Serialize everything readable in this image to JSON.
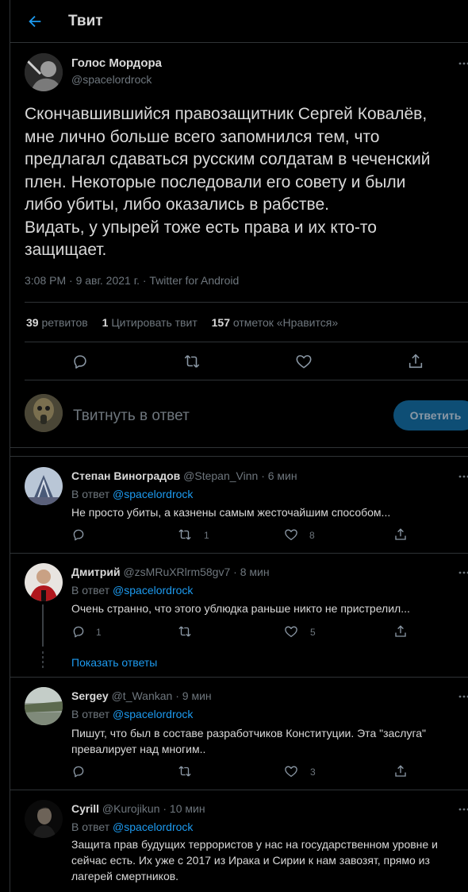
{
  "header": {
    "title": "Твит"
  },
  "main_tweet": {
    "display_name": "Голос Мордора",
    "handle": "@spacelordrock",
    "text_lines": [
      "Скончавшившийся правозащитник Сергей Ковалёв,",
      "мне лично больше всего запомнился тем, что",
      "предлагал сдаваться русским солдатам в чеченский",
      "плен. Некоторые последовали его совету и были",
      "либо убиты, либо оказались в рабстве.",
      "Видать, у упырей тоже есть права и их кто-то",
      "защищает."
    ],
    "meta": "3:08 PM · 9 авг. 2021 г. · Twitter for Android",
    "stats": {
      "retweets_count": "39",
      "retweets_label": "ретвитов",
      "quotes_count": "1",
      "quotes_label": "Цитировать твит",
      "likes_count": "157",
      "likes_label": "отметок «Нравится»"
    }
  },
  "compose": {
    "placeholder": "Твитнуть в ответ",
    "button": "Ответить"
  },
  "reply_prefix": "В ответ",
  "replies": [
    {
      "name": "Степан Виноградов",
      "handle": "@Stepan_Vinn",
      "time": "· 6 мин",
      "reply_to": "@spacelordrock",
      "lines": [
        "Не просто убиты, а казнены самым жесточайшим способом..."
      ],
      "counts": {
        "reply": "",
        "retweet": "1",
        "like": "8"
      }
    },
    {
      "name": "Дмитрий",
      "handle": "@zsMRuXRlrm58gv7",
      "time": "· 8 мин",
      "reply_to": "@spacelordrock",
      "lines": [
        "Очень странно, что этого ублюдка раньше никто не пристрелил..."
      ],
      "counts": {
        "reply": "1",
        "retweet": "",
        "like": "5"
      },
      "show_replies": "Показать ответы"
    },
    {
      "name": "Sergey",
      "handle": "@t_Wankan",
      "time": "· 9 мин",
      "reply_to": "@spacelordrock",
      "lines": [
        "Пишут, что был в составе разработчиков Конституции. Эта \"заслуга\"",
        "превалирует над многим.."
      ],
      "counts": {
        "reply": "",
        "retweet": "",
        "like": "3"
      }
    },
    {
      "name": "Cyrill",
      "handle": "@Kurojikun",
      "time": "· 10 мин",
      "reply_to": "@spacelordrock",
      "lines": [
        "Защита прав будущих террористов у нас на государственном уровне и",
        "сейчас есть. Их уже с 2017 из Ирака и Сирии к нам завозят, прямо из",
        "лагерей смертников."
      ]
    }
  ],
  "colors": {
    "accent": "#1d9bf0",
    "muted": "#6e767d",
    "border": "#2f3336",
    "button_bg": "#0e4e75"
  },
  "icons": [
    "back-arrow-icon",
    "more-icon",
    "reply-icon",
    "retweet-icon",
    "like-icon",
    "share-icon"
  ]
}
